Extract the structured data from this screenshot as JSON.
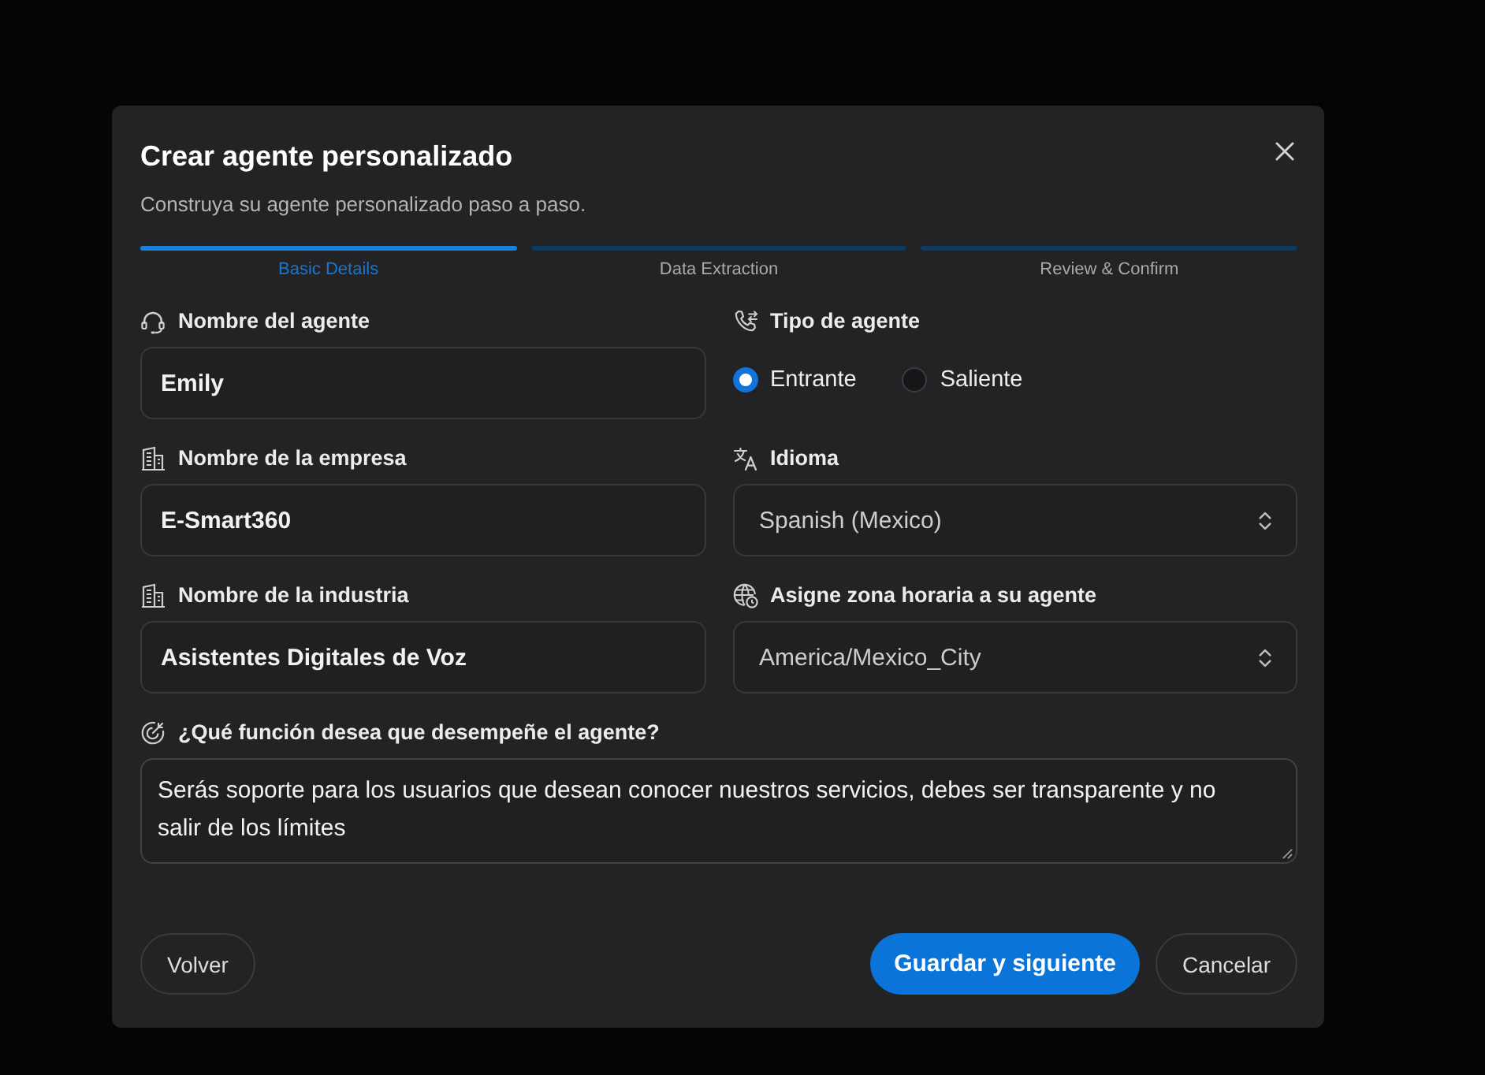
{
  "dialog": {
    "title": "Crear agente personalizado",
    "subtitle": "Construya su agente personalizado paso a paso."
  },
  "steps": [
    {
      "label": "Basic Details",
      "selected": true
    },
    {
      "label": "Data Extraction",
      "selected": false
    },
    {
      "label": "Review & Confirm",
      "selected": false
    }
  ],
  "fields": [
    {
      "kind": "text",
      "label": "Nombre del agente",
      "value": "Emily"
    },
    {
      "kind": "radio",
      "label": "Tipo de agente",
      "options": [
        {
          "label": "Entrante",
          "selected": true
        },
        {
          "label": "Saliente",
          "selected": false
        }
      ]
    },
    {
      "kind": "text",
      "label": "Nombre de la empresa",
      "value": "E-Smart360"
    },
    {
      "kind": "select",
      "label": "Idioma",
      "value": "Spanish (Mexico)"
    },
    {
      "kind": "text",
      "label": "Nombre de la industria",
      "value": "Asistentes Digitales de Voz"
    },
    {
      "kind": "select",
      "label": "Asigne zona horaria a su agente",
      "value": "America/Mexico_City"
    },
    {
      "kind": "textarea",
      "label": "¿Qué función desea que desempeñe el agente?",
      "value": "Serás soporte para los usuarios que desean conocer nuestros servicios, debes ser transparente y no salir de los límites"
    }
  ],
  "footer": {
    "back_button": "Volver",
    "actions": [
      {
        "label": "Guardar y siguiente",
        "kind": "primary"
      },
      {
        "label": "Cancelar",
        "kind": "secondary"
      }
    ]
  }
}
